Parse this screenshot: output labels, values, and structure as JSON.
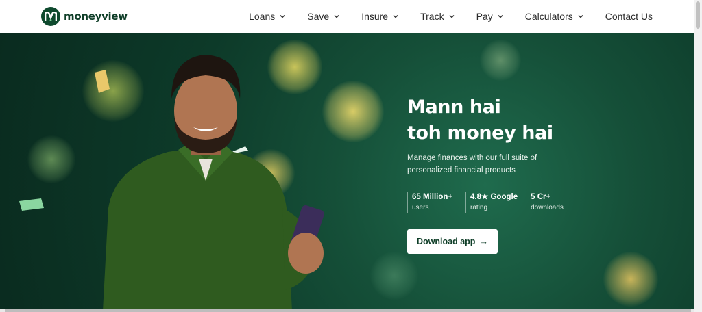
{
  "brand": {
    "name": "moneyview",
    "accent": "#0f4a2e"
  },
  "nav": {
    "items": [
      {
        "label": "Loans",
        "dropdown": true
      },
      {
        "label": "Save",
        "dropdown": true
      },
      {
        "label": "Insure",
        "dropdown": true
      },
      {
        "label": "Track",
        "dropdown": true
      },
      {
        "label": "Pay",
        "dropdown": true
      },
      {
        "label": "Calculators",
        "dropdown": true
      },
      {
        "label": "Contact Us",
        "dropdown": false
      }
    ]
  },
  "hero": {
    "headline_line1": "Mann hai",
    "headline_line2": "toh money hai",
    "subtext": "Manage finances with our full suite of personalized financial products",
    "stats": [
      {
        "value": "65 Million+",
        "label": "users"
      },
      {
        "value": "4.8★ Google",
        "label": "rating"
      },
      {
        "value": "5 Cr+",
        "label": "downloads"
      }
    ],
    "cta_label": "Download app",
    "cta_icon": "arrow-right-icon"
  }
}
